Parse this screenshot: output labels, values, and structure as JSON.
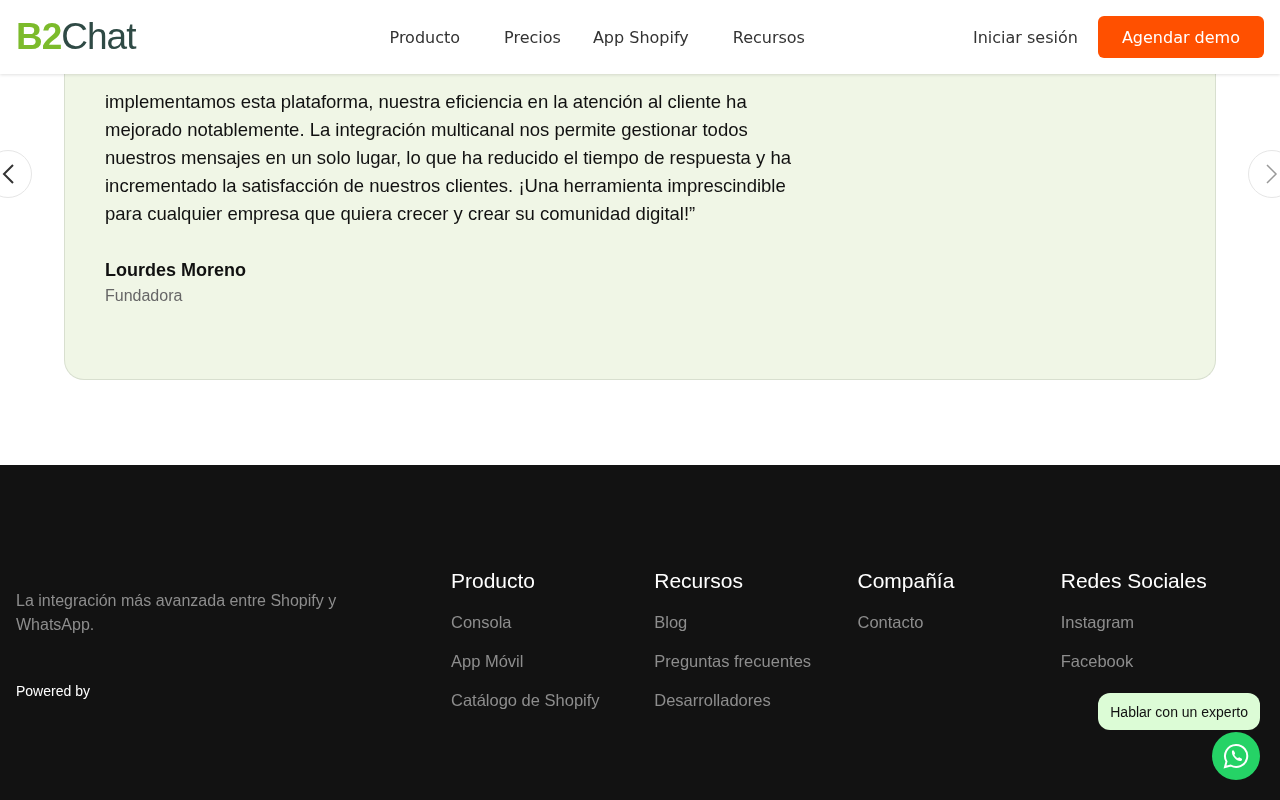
{
  "header": {
    "logo": {
      "mark": "B2",
      "word": "Chat"
    },
    "nav": [
      "Producto",
      "Precios",
      "App Shopify",
      "Recursos"
    ],
    "login": "Iniciar sesión",
    "cta": "Agendar demo"
  },
  "testimonial": {
    "quote": "implementamos esta plataforma, nuestra eficiencia en la atención al cliente ha mejorado notablemente. La integración multicanal nos permite gestionar todos nuestros mensajes en un solo lugar, lo que ha reducido el tiempo de respuesta y ha incrementado la satisfacción de nuestros clientes. ¡Una herramienta imprescindible para cualquier empresa que quiera crecer y crear su comunidad digital!”",
    "author": "Lourdes Moreno",
    "role": "Fundadora"
  },
  "footer": {
    "tagline": "La integración más avanzada entre Shopify y WhatsApp.",
    "powered_by": "Powered by",
    "columns": [
      {
        "title": "Producto",
        "links": [
          "Consola",
          "App Móvil",
          "Catálogo de Shopify"
        ]
      },
      {
        "title": "Recursos",
        "links": [
          "Blog",
          "Preguntas frecuentes",
          "Desarrolladores"
        ]
      },
      {
        "title": "Compañía",
        "links": [
          "Contacto"
        ]
      },
      {
        "title": "Redes Sociales",
        "links": [
          "Instagram",
          "Facebook"
        ]
      }
    ]
  },
  "chat_widget": {
    "label": "Hablar con un experto"
  }
}
